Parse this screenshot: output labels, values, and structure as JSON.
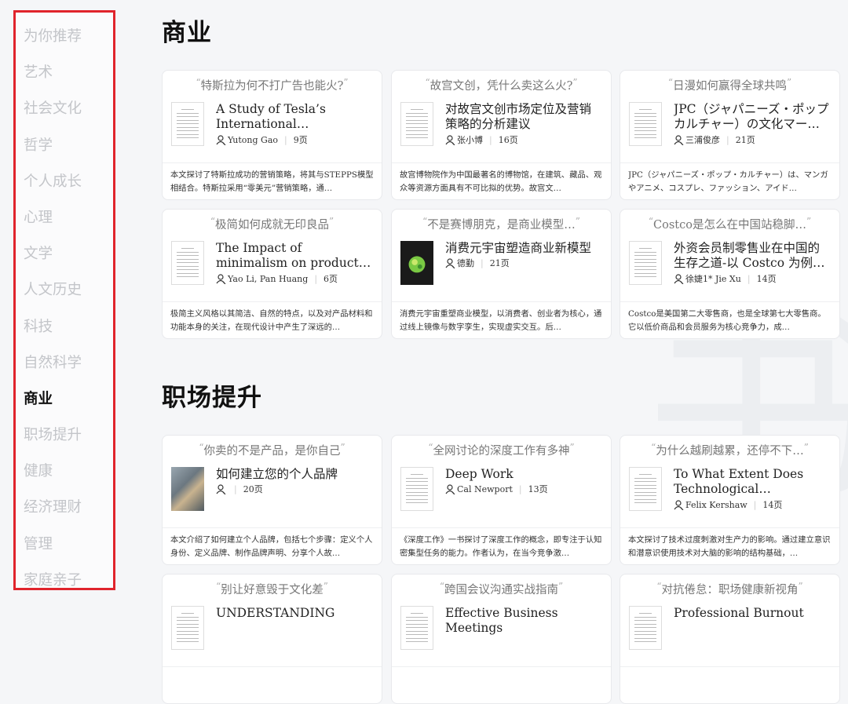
{
  "sidebar": {
    "items": [
      {
        "label": "为你推荐",
        "active": false
      },
      {
        "label": "艺术",
        "active": false
      },
      {
        "label": "社会文化",
        "active": false
      },
      {
        "label": "哲学",
        "active": false
      },
      {
        "label": "个人成长",
        "active": false
      },
      {
        "label": "心理",
        "active": false
      },
      {
        "label": "文学",
        "active": false
      },
      {
        "label": "人文历史",
        "active": false
      },
      {
        "label": "科技",
        "active": false
      },
      {
        "label": "自然科学",
        "active": false
      },
      {
        "label": "商业",
        "active": true
      },
      {
        "label": "职场提升",
        "active": false
      },
      {
        "label": "健康",
        "active": false
      },
      {
        "label": "经济理财",
        "active": false
      },
      {
        "label": "管理",
        "active": false
      },
      {
        "label": "家庭亲子",
        "active": false
      }
    ]
  },
  "sections": [
    {
      "title": "商业",
      "cards": [
        {
          "quote": "特斯拉为何不打广告也能火?",
          "title": "A Study of Tesla’s International Marketing…",
          "author": "Yutong Gao",
          "pages": "9页",
          "thumb": "doc",
          "desc": "本文探讨了特斯拉成功的营销策略，将其与STEPPS模型相结合。特斯拉采用“零美元”营销策略，通…"
        },
        {
          "quote": "故宫文创，凭什么卖这么火?",
          "title": "对故宫文创市场定位及营销策略的分析建议",
          "author": "张小博",
          "pages": "16页",
          "thumb": "doc",
          "desc": "故宫博物院作为中国最著名的博物馆，在建筑、藏品、观众等资源方面具有不可比拟的优势。故宫文…"
        },
        {
          "quote": "日漫如何赢得全球共鸣",
          "title": "JPC（ジャパニーズ・ポップカルチャー）の文化マーケ…",
          "author": "三浦俊彦",
          "pages": "21页",
          "thumb": "doc",
          "desc": "JPC（ジャパニーズ・ポップ・カルチャー）は、マンガやアニメ、コスプレ、ファッション、アイド…"
        },
        {
          "quote": "极简如何成就无印良品",
          "title": "The Impact of minimalism on product Design: A Cas…",
          "author": "Yao Li, Pan Huang",
          "pages": "6页",
          "thumb": "doc",
          "desc": "极简主义风格以其简洁、自然的特点，以及对产品材料和功能本身的关注，在现代设计中产生了深远的…"
        },
        {
          "quote": "不是赛博朋克，是商业模型…",
          "title": "消费元宇宙塑造商业新模型",
          "author": "德勤",
          "pages": "21页",
          "thumb": "dark",
          "desc": "消费元宇宙重塑商业模型，以消费者、创业者为核心，通过线上镜像与数字孪生，实现虚实交互。后…"
        },
        {
          "quote": "Costco是怎么在中国站稳脚…",
          "title": "外资会员制零售业在中国的生存之道-以 Costco 为例 The…",
          "author": "徐婕1* Jie Xu",
          "pages": "14页",
          "thumb": "doc",
          "desc": "Costco是美国第二大零售商，也是全球第七大零售商。它以低价商品和会员服务为核心竞争力，成…"
        }
      ]
    },
    {
      "title": "职场提升",
      "cards": [
        {
          "quote": "你卖的不是产品，是你自己",
          "title": "如何建立您的个人品牌",
          "author": "",
          "pages": "20页",
          "thumb": "photo",
          "desc": "本文介绍了如何建立个人品牌，包括七个步骤：定义个人身份、定义品牌、制作品牌声明、分享个人故…"
        },
        {
          "quote": "全网讨论的深度工作有多神",
          "title": "Deep Work",
          "author": "Cal Newport",
          "pages": "13页",
          "thumb": "doc",
          "desc": "《深度工作》一书探讨了深度工作的概念，即专注于认知密集型任务的能力。作者认为，在当今竞争激…"
        },
        {
          "quote": "为什么越刷越累，还停不下…",
          "title": "To What Extent Does Technological…",
          "author": "Felix Kershaw",
          "pages": "14页",
          "thumb": "doc",
          "desc": "本文探讨了技术过度刺激对生产力的影响。通过建立意识和潜意识使用技术对大脑的影响的结构基础，…"
        },
        {
          "quote": "别让好意毁于文化差",
          "title": "UNDERSTANDING",
          "author": "",
          "pages": "",
          "thumb": "doc",
          "desc": ""
        },
        {
          "quote": "跨国会议沟通实战指南",
          "title": "Effective Business Meetings",
          "author": "",
          "pages": "",
          "thumb": "doc",
          "desc": ""
        },
        {
          "quote": "对抗倦怠：职场健康新视角",
          "title": "Professional Burnout",
          "author": "",
          "pages": "",
          "thumb": "doc",
          "desc": ""
        }
      ]
    }
  ]
}
